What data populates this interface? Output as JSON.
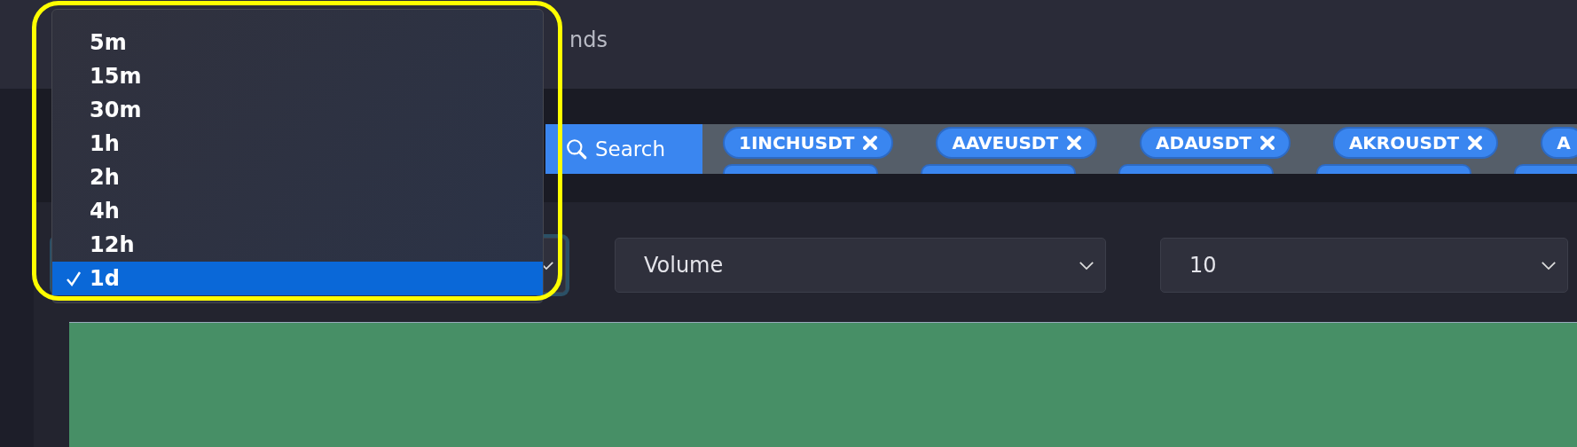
{
  "nav": {
    "partial_text": "nds"
  },
  "search": {
    "button": "Search",
    "tags": [
      {
        "label": "1INCHUSDT",
        "removable": true
      },
      {
        "label": "AAVEUSDT",
        "removable": true
      },
      {
        "label": "ADAUSDT",
        "removable": true
      },
      {
        "label": "AKROUSDT",
        "removable": true
      },
      {
        "label": "A",
        "removable": false
      }
    ],
    "clipped_tags": [
      {
        "kind": "clipped"
      },
      {
        "kind": "clipped"
      },
      {
        "kind": "clipped"
      },
      {
        "kind": "clipped"
      },
      {
        "kind": "clipped"
      }
    ]
  },
  "selects": [
    {
      "focused": true
    },
    {
      "value": "Volume",
      "focused": false
    },
    {
      "value": "10",
      "focused": false
    }
  ],
  "dropdown": {
    "options": [
      {
        "label": "5m",
        "selected": false
      },
      {
        "label": "15m",
        "selected": false
      },
      {
        "label": "30m",
        "selected": false
      },
      {
        "label": "1h",
        "selected": false
      },
      {
        "label": "2h",
        "selected": false
      },
      {
        "label": "4h",
        "selected": false
      },
      {
        "label": "12h",
        "selected": false
      },
      {
        "label": "1d",
        "selected": true
      }
    ]
  },
  "annotation": {
    "kind": "ring"
  }
}
